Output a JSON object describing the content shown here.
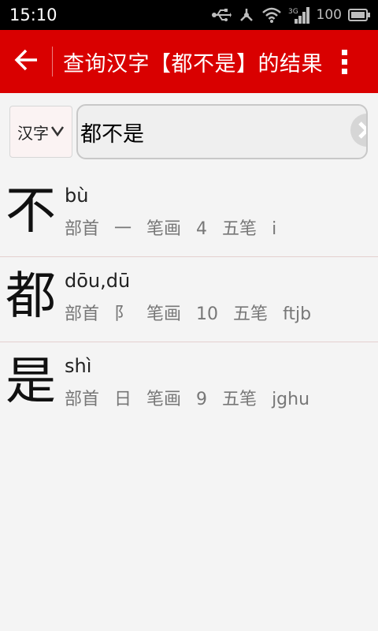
{
  "status_bar": {
    "time": "15:10",
    "battery_level": "100",
    "network_label": "3G"
  },
  "app_bar": {
    "title": "查询汉字【都不是】的结果"
  },
  "search": {
    "type_label": "汉字",
    "query": "都不是"
  },
  "results": [
    {
      "char": "不",
      "pinyin": "bù",
      "radical_label": "部首",
      "radical": "一",
      "strokes_label": "笔画",
      "strokes": "4",
      "wubi_label": "五笔",
      "wubi": "i"
    },
    {
      "char": "都",
      "pinyin": "dōu,dū",
      "radical_label": "部首",
      "radical": "阝",
      "strokes_label": "笔画",
      "strokes": "10",
      "wubi_label": "五笔",
      "wubi": "ftjb"
    },
    {
      "char": "是",
      "pinyin": "shì",
      "radical_label": "部首",
      "radical": "日",
      "strokes_label": "笔画",
      "strokes": "9",
      "wubi_label": "五笔",
      "wubi": "jghu"
    }
  ],
  "colors": {
    "app_bar": "#d90000",
    "status_bar": "#000000",
    "background": "#f4f4f4"
  },
  "icons": [
    "usb-icon",
    "share-icon",
    "wifi-icon",
    "signal-icon",
    "battery-icon",
    "back-arrow-icon",
    "overflow-menu-icon",
    "chevron-down-icon",
    "clear-icon",
    "search-icon"
  ]
}
